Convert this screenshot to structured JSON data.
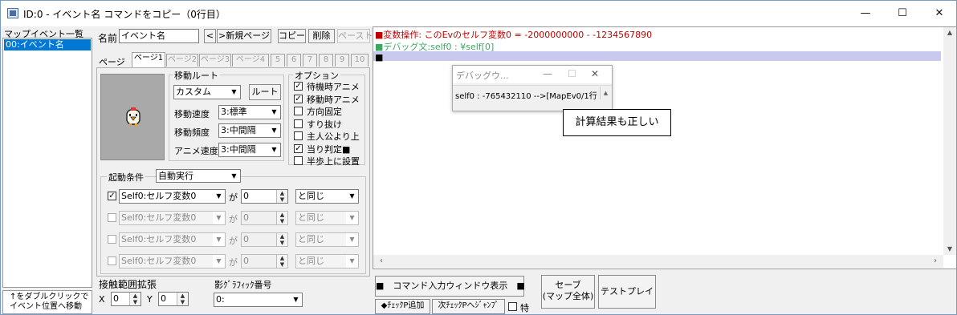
{
  "window": {
    "title": "ID:0 - イベント名 コマンドをコピー（0行目）",
    "controls": {
      "minimize": "—",
      "maximize": "☐",
      "close": "✕"
    }
  },
  "event_list": {
    "header": "マップイベント一覧",
    "items": [
      "00:イベント名"
    ],
    "hint_line1": "↑をダブルクリックで",
    "hint_line2": "イベント位置へ移動"
  },
  "toolbar": {
    "name_label": "名前",
    "name_value": "イベント名",
    "prev": "<",
    "new_page": ">新規ページ",
    "copy": "コピー",
    "delete": "削除",
    "paste": "ペースト"
  },
  "pages": {
    "label": "ページ",
    "tabs": [
      "ページ1",
      "ページ2",
      "ページ3",
      "ページ4",
      "5",
      "6",
      "7",
      "8",
      "9",
      "10"
    ]
  },
  "move_route": {
    "title": "移動ルート",
    "type": "カスタム",
    "route_button": "ルート",
    "speed_label": "移動速度",
    "speed": "3:標準",
    "freq_label": "移動頻度",
    "freq": "3:中間隔",
    "anim_label": "アニメ速度",
    "anim": "3:中間隔"
  },
  "options": {
    "title": "オプション",
    "items": [
      {
        "label": "待機時アニメ",
        "mark": "✓"
      },
      {
        "label": "移動時アニメ",
        "mark": "✓"
      },
      {
        "label": "方向固定",
        "mark": ""
      },
      {
        "label": "すり抜け",
        "mark": ""
      },
      {
        "label": "主人公より上",
        "mark": ""
      },
      {
        "label": "当り判定■",
        "mark": "✓"
      },
      {
        "label": "半歩上に設置",
        "mark": ""
      }
    ]
  },
  "trigger": {
    "title": "起動条件",
    "value": "自動実行",
    "ga": "が",
    "rows": [
      {
        "mark": "✓",
        "var": "Self0:セルフ変数0",
        "num": "0",
        "cmp": "と同じ"
      },
      {
        "mark": "",
        "var": "Self0:セルフ変数0",
        "num": "0",
        "cmp": "と同じ"
      },
      {
        "mark": "",
        "var": "Self0:セルフ変数0",
        "num": "0",
        "cmp": "と同じ"
      },
      {
        "mark": "",
        "var": "Self0:セルフ変数0",
        "num": "0",
        "cmp": "と同じ"
      }
    ]
  },
  "contact": {
    "title": "接触範囲拡張",
    "x_label": "X",
    "x": "0",
    "y_label": "Y",
    "y": "0"
  },
  "shadow": {
    "title": "影ｸﾞﾗﾌｨｯｸ番号",
    "value": "0:"
  },
  "code": {
    "lines": [
      {
        "text": "■変数操作: このEvのセルフ変数0 = -2000000000 - -1234567890",
        "color": "#c00000"
      },
      {
        "text": "■デバッグ文:self0 : ¥self[0]",
        "color": "#3aa860"
      },
      {
        "text": "■",
        "color": "#000000"
      }
    ]
  },
  "debug_window": {
    "title": "デバッグウ...",
    "text": "self0 : -765432110 -->[MapEv0/1行"
  },
  "annotation": "計算結果も正しい",
  "bottom": {
    "cmd_input": "■　コマンド入力ウィンドウ表示　■",
    "add_check": "◆ﾁｪｯｸP追加",
    "next_check": "次ﾁｪｯｸPへｼﾞｬﾝﾌﾟ",
    "special": "特",
    "save_line1": "セーブ",
    "save_line2": "(マップ全体)",
    "test_play": "テストプレイ"
  },
  "colors": {
    "selection": "#0078d7",
    "highlight_row": "#c9c9ef",
    "title_icon": "#4a6f9e"
  }
}
